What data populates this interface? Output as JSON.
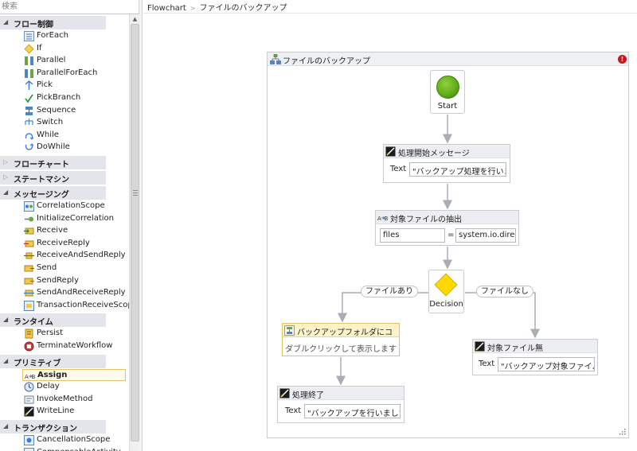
{
  "search": {
    "placeholder": "検索"
  },
  "toolbox": {
    "categories": [
      {
        "label": "フロー制御",
        "expanded": true,
        "items": [
          "ForEach",
          "If",
          "Parallel",
          "ParallelForEach",
          "Pick",
          "PickBranch",
          "Sequence",
          "Switch",
          "While",
          "DoWhile"
        ]
      },
      {
        "label": "フローチャート",
        "expanded": false,
        "items": []
      },
      {
        "label": "ステートマシン",
        "expanded": false,
        "items": []
      },
      {
        "label": "メッセージング",
        "expanded": true,
        "items": [
          "CorrelationScope",
          "InitializeCorrelation",
          "Receive",
          "ReceiveReply",
          "ReceiveAndSendReply",
          "Send",
          "SendReply",
          "SendAndReceiveReply",
          "TransactionReceiveScope"
        ]
      },
      {
        "label": "ランタイム",
        "expanded": true,
        "items": [
          "Persist",
          "TerminateWorkflow"
        ]
      },
      {
        "label": "プリミティブ",
        "expanded": true,
        "items": [
          "Assign",
          "Delay",
          "InvokeMethod",
          "WriteLine"
        ]
      },
      {
        "label": "トランザクション",
        "expanded": true,
        "items": [
          "CancellationScope",
          "CompensableActivity"
        ]
      }
    ],
    "selected_item": "Assign"
  },
  "breadcrumb": {
    "root": "Flowchart",
    "current": "ファイルのバックアップ"
  },
  "flowchart": {
    "title": "ファイルのバックアップ",
    "start_label": "Start",
    "write_start": {
      "title": "処理開始メッセージ",
      "field_label": "Text",
      "field_value": "\"バックアップ処理を行いま\""
    },
    "assign": {
      "title": "対象ファイルの抽出",
      "to": "files",
      "op": "=",
      "value": "system.io.directo"
    },
    "decision_label": "Decision",
    "true_label": "ファイルあり",
    "false_label": "ファイルなし",
    "sequence": {
      "title": "バックアップフォルダにコ",
      "hint": "ダブルクリックして表示します"
    },
    "write_none": {
      "title": "対象ファイル無",
      "field_label": "Text",
      "field_value": "\"バックアップ対象ファイル\""
    },
    "write_end": {
      "title": "処理終了",
      "field_label": "Text",
      "field_value": "\"バックアップを行いました\""
    }
  },
  "colors": {
    "start_green": "#5fa917",
    "decision_yellow": "#ffd800",
    "error_red": "#c4161c",
    "selection_border": "#e5c365"
  }
}
